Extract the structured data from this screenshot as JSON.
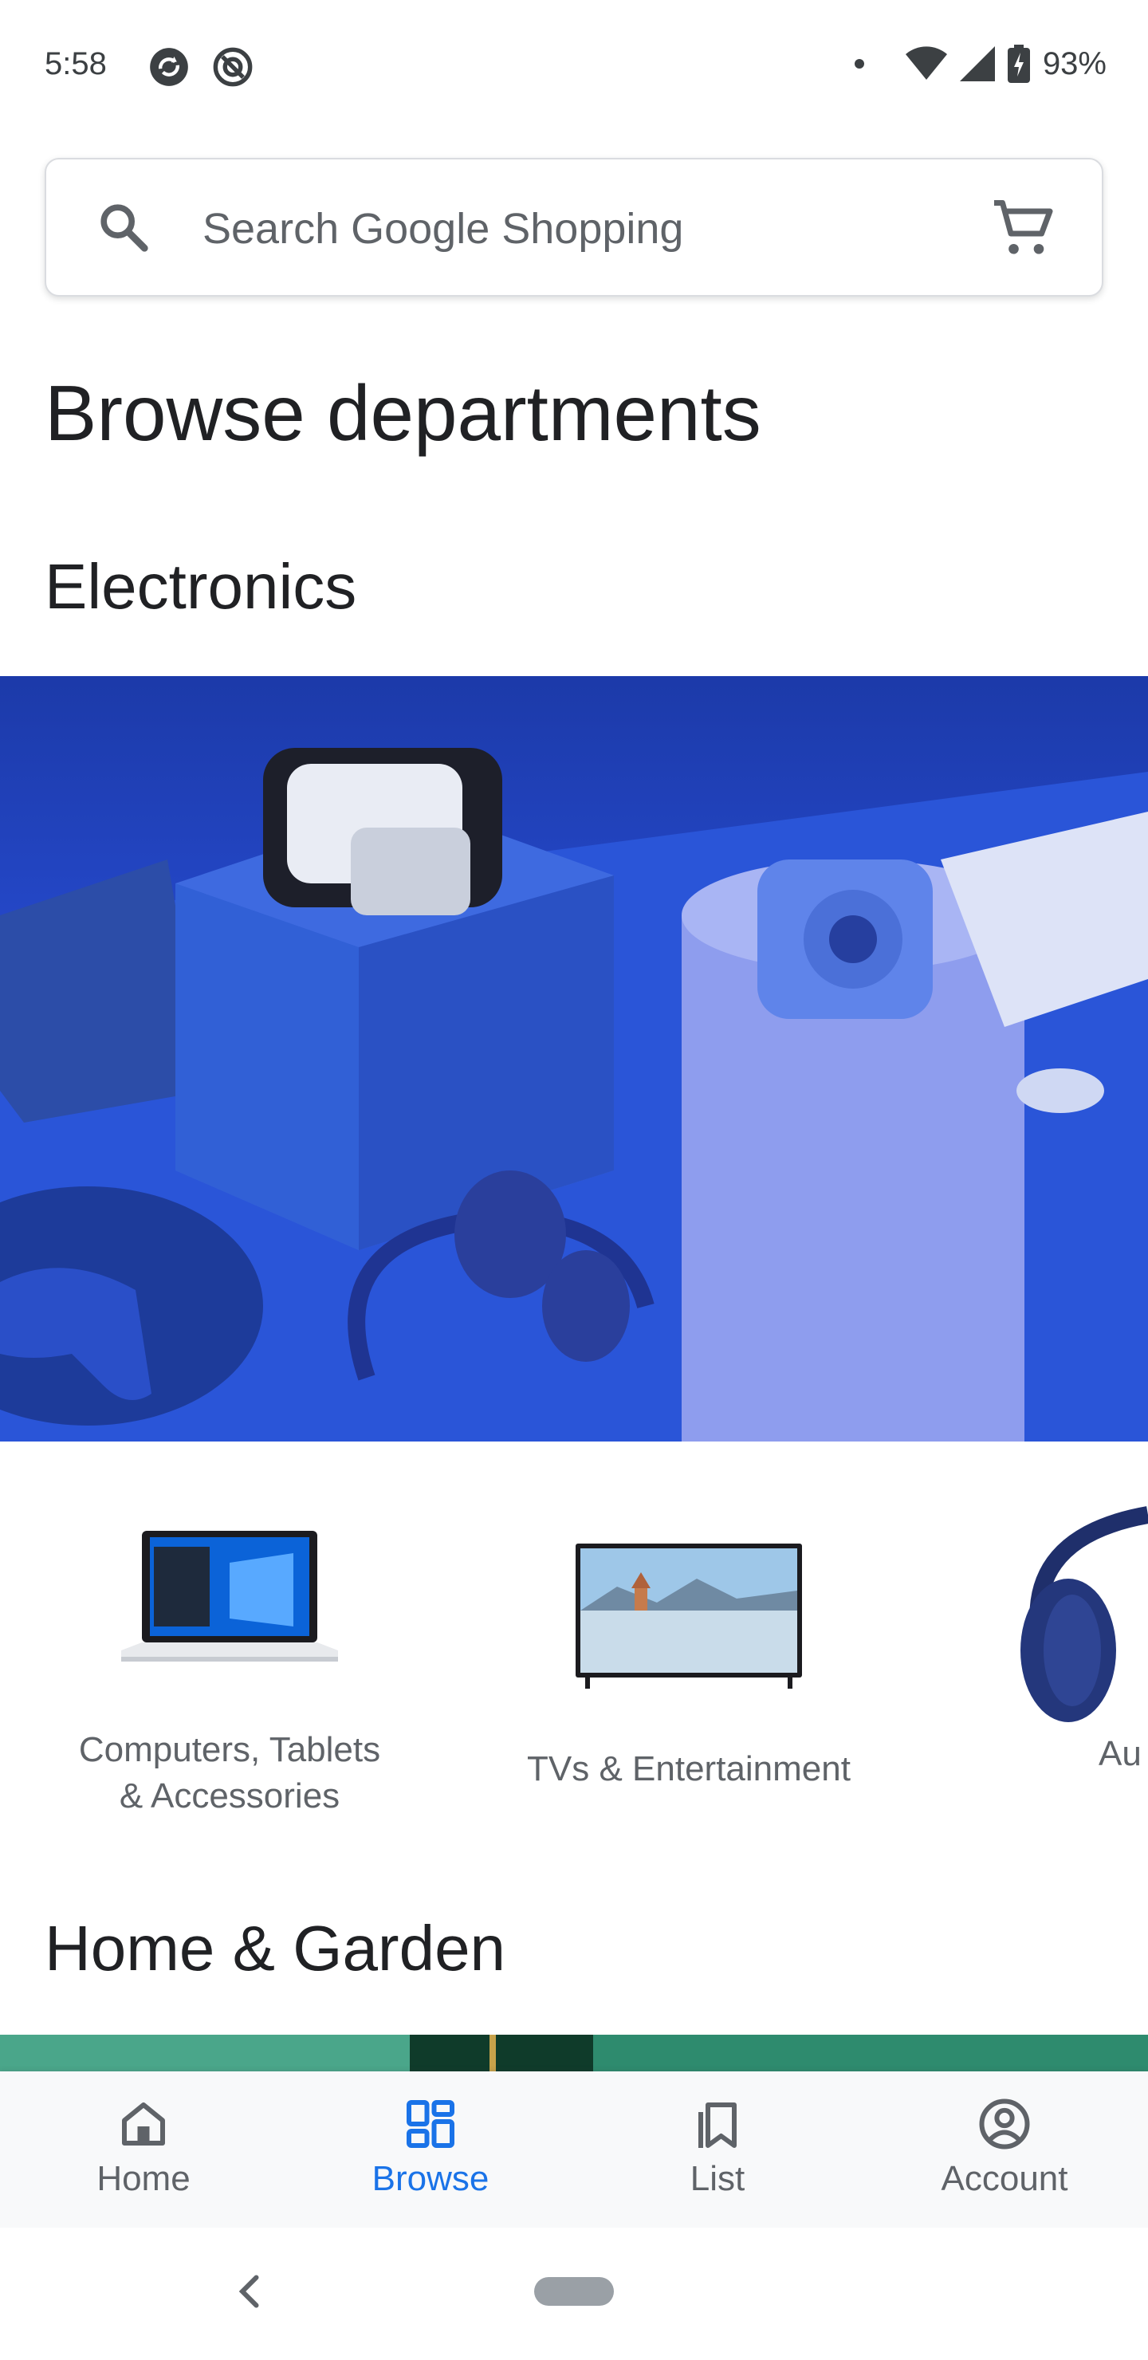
{
  "status_bar": {
    "time": "5:58",
    "battery": "93%",
    "icons": [
      "sync-icon",
      "do-not-disturb-icon",
      "notification-dot-icon",
      "wifi-icon",
      "signal-icon",
      "battery-charging-icon"
    ]
  },
  "search": {
    "placeholder": "Search Google Shopping",
    "icons": [
      "search-icon",
      "cart-icon"
    ]
  },
  "page": {
    "title": "Browse departments"
  },
  "sections": {
    "electronics": {
      "title": "Electronics",
      "categories": [
        {
          "label_line1": "Computers, Tablets",
          "label_line2": "& Accessories",
          "icon": "laptop-image"
        },
        {
          "label": "TVs & Entertainment",
          "icon": "tv-image"
        },
        {
          "label": "Au",
          "icon": "headphones-image"
        }
      ]
    },
    "home_garden": {
      "title": "Home & Garden"
    }
  },
  "bottom_nav": {
    "items": [
      {
        "label": "Home",
        "icon": "home-icon",
        "active": false
      },
      {
        "label": "Browse",
        "icon": "browse-icon",
        "active": true
      },
      {
        "label": "List",
        "icon": "bookmark-icon",
        "active": false
      },
      {
        "label": "Account",
        "icon": "account-icon",
        "active": false
      }
    ]
  },
  "colors": {
    "accent": "#1a73e8",
    "banner_blue": "#1a3bb8",
    "text_secondary": "#5f6368"
  }
}
